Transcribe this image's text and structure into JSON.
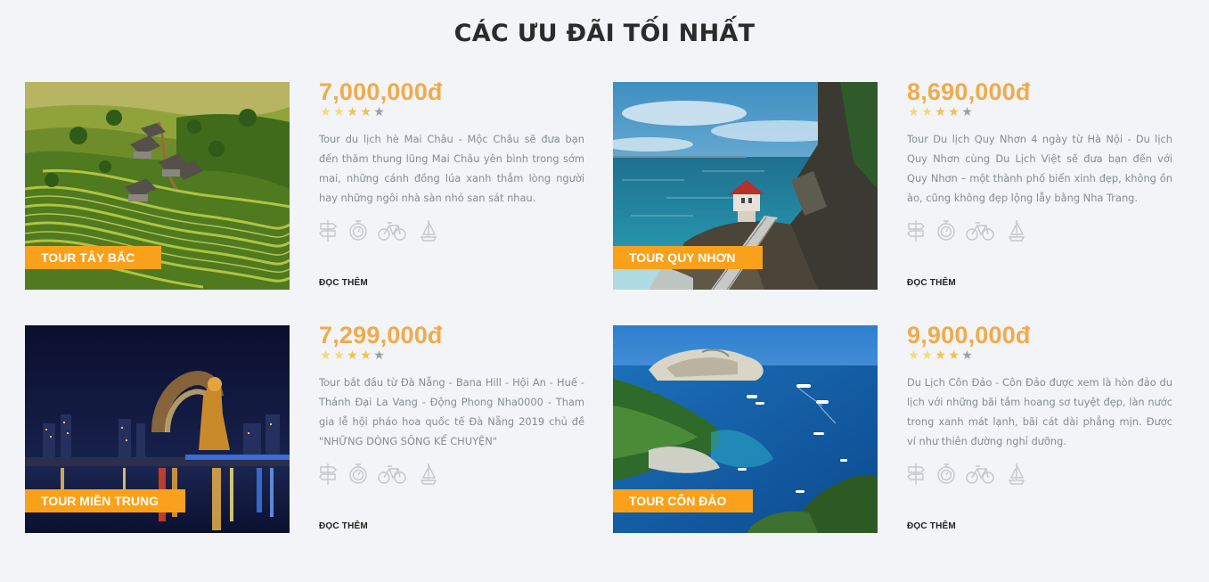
{
  "section": {
    "title": "CÁC ƯU ĐÃI TỐI NHẤT"
  },
  "accent_color": "#f9a11b",
  "price_color": "#f0ab4c",
  "tours": [
    {
      "tag": "TOUR TÂY BẮC",
      "image": "rice-terrace-village-photo",
      "price": "7,000,000đ",
      "rating": 4,
      "rating_max": 5,
      "description": "Tour du lịch hè Mai Châu - Mộc Châu sẽ đưa bạn đến thăm thung lũng Mai Châu yên bình trong sớm mai, những cánh đồng lúa xanh thẳm lòng người hay những ngôi nhà sàn nhỏ san sát nhau.",
      "icons": [
        "signpost-icon",
        "stopwatch-icon",
        "bicycle-icon",
        "sailboat-icon"
      ],
      "read_more": "ĐỌC THÊM"
    },
    {
      "tag": "TOUR QUY NHƠN",
      "image": "coastal-lighthouse-photo",
      "price": "8,690,000đ",
      "rating": 4,
      "rating_max": 5,
      "description": "Tour Du lịch Quy Nhơn 4 ngày từ Hà Nội - Du lịch Quy Nhơn cùng Du Lịch Việt sẽ đưa bạn đến với Quy Nhơn – một thành phố biển xinh đẹp, không ồn ào, cũng không đẹp lộng lẫy bằng Nha Trang.",
      "icons": [
        "signpost-icon",
        "stopwatch-icon",
        "bicycle-icon",
        "sailboat-icon"
      ],
      "read_more": "ĐỌC THÊM"
    },
    {
      "tag": "TOUR MIỀN TRUNG",
      "image": "danang-night-dragon-photo",
      "price": "7,299,000đ",
      "rating": 4,
      "rating_max": 5,
      "description": "Tour bắt đầu từ Đà Nẵng - Bana Hill - Hội An - Huế - Thánh Đại La Vang - Động Phong Nha0000 - Tham gia lễ hội pháo hoa quốc tế Đà Nẵng 2019 chủ đề \"NHỮNG DÒNG SÔNG KỂ CHUYỆN\"",
      "icons": [
        "signpost-icon",
        "stopwatch-icon",
        "bicycle-icon",
        "sailboat-icon"
      ],
      "read_more": "ĐỌC THÊM"
    },
    {
      "tag": "TOUR CÔN ĐẢO",
      "image": "island-bay-boats-photo",
      "price": "9,900,000đ",
      "rating": 4,
      "rating_max": 5,
      "description": "Du Lịch Côn Đảo - Côn Đảo được xem là hòn đảo du lịch với những bãi tắm hoang sơ tuyệt đẹp, làn nước trong xanh mát lạnh, bãi cát dài phẳng mịn. Được ví như thiên đường nghỉ dưỡng.",
      "icons": [
        "signpost-icon",
        "stopwatch-icon",
        "bicycle-icon",
        "sailboat-icon"
      ],
      "read_more": "ĐỌC THÊM"
    }
  ]
}
